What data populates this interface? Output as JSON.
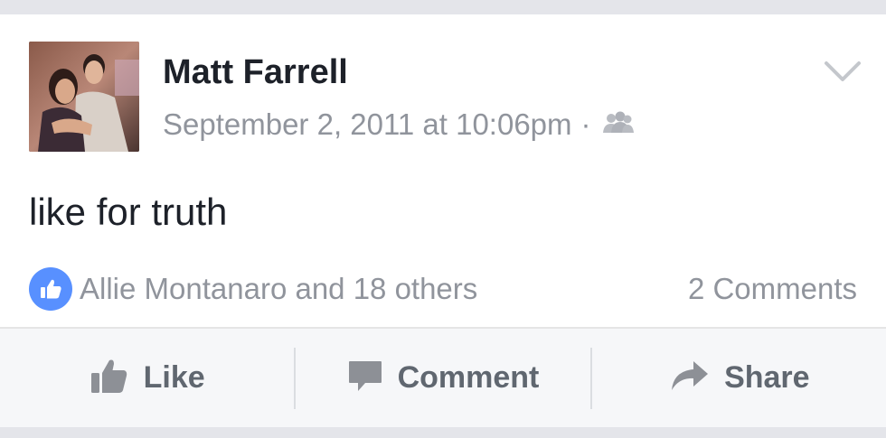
{
  "post": {
    "author": "Matt Farrell",
    "timestamp": "September 2, 2011 at 10:06pm",
    "separator": "·",
    "privacy_icon": "friends-icon",
    "text": "like for truth",
    "menu_icon": "chevron-down-icon"
  },
  "reactions": {
    "icon": "thumbs-up-icon",
    "summary": "Allie Montanaro and 18 others",
    "comments": "2 Comments"
  },
  "actions": {
    "like": {
      "label": "Like",
      "icon": "thumbs-up-icon"
    },
    "comment": {
      "label": "Comment",
      "icon": "comment-bubble-icon"
    },
    "share": {
      "label": "Share",
      "icon": "share-arrow-icon"
    }
  },
  "colors": {
    "accent": "#5890ff",
    "muted_text": "#90949c",
    "action_text": "#606770",
    "body_text": "#1d2129"
  }
}
